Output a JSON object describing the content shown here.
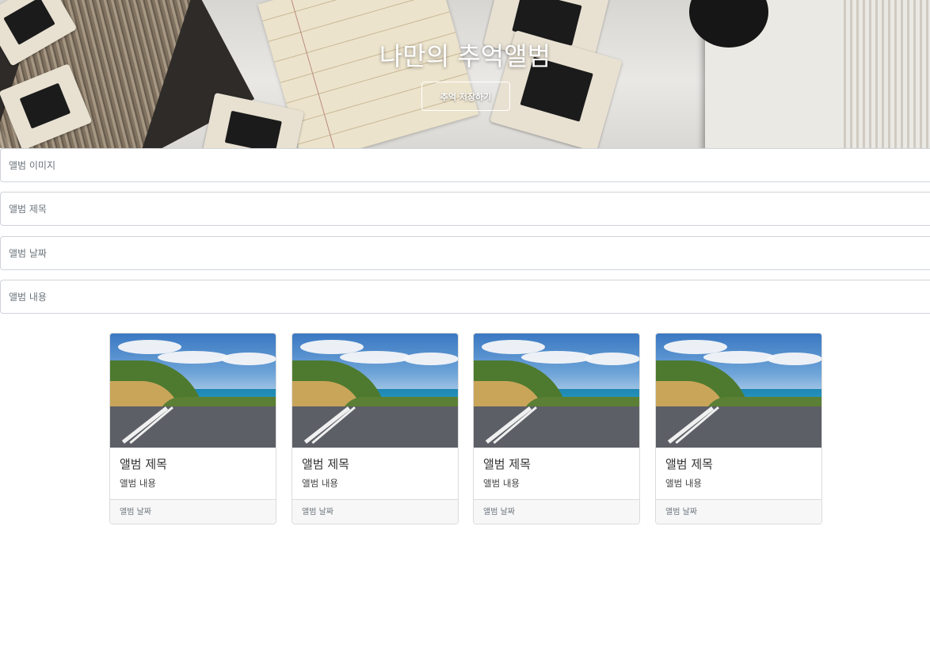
{
  "hero": {
    "title": "나만의 추억앨범",
    "button_label": "추억 저장하기"
  },
  "form": {
    "image_placeholder": "앨범 이미지",
    "title_placeholder": "앨범 제목",
    "date_placeholder": "앨범 날짜",
    "content_placeholder": "앨범 내용"
  },
  "cards": [
    {
      "title": "앨범 제목",
      "content": "앨범 내용",
      "date": "앨범 날짜"
    },
    {
      "title": "앨범 제목",
      "content": "앨범 내용",
      "date": "앨범 날짜"
    },
    {
      "title": "앨범 제목",
      "content": "앨범 내용",
      "date": "앨범 날짜"
    },
    {
      "title": "앨범 제목",
      "content": "앨범 내용",
      "date": "앨범 날짜"
    }
  ],
  "colors": {
    "card_border": "#dcdcdc",
    "card_footer_bg": "#f7f7f7",
    "input_border": "#cfd4da"
  }
}
